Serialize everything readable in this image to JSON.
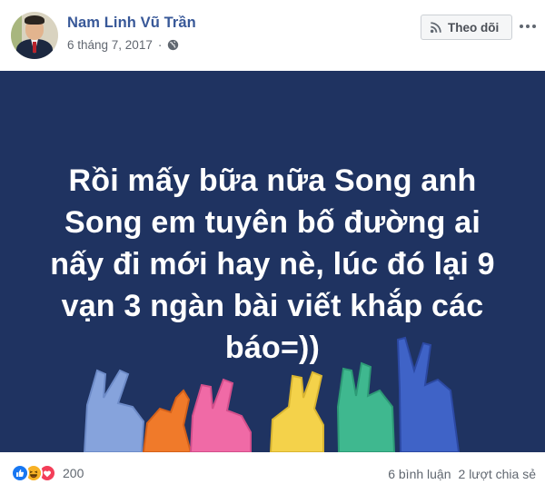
{
  "post": {
    "author": "Nam Linh Vũ Trần",
    "date": "6 tháng 7, 2017",
    "separator": "·",
    "privacy_icon": "globe-icon",
    "follow_icon": "rss-icon",
    "follow_label": "Theo dõi",
    "more_icon": "ellipsis-icon",
    "image_text": "Rồi mấy bữa nữa Song anh Song em tuyên bố đường ai nấy đi mới hay nè, lúc đó lại 9 vạn 3 ngàn bài viết khắp các báo=))",
    "image_background": "#1f3361"
  },
  "footer": {
    "reactions": [
      "like-icon",
      "haha-icon",
      "love-icon"
    ],
    "reaction_count": "200",
    "comments": "6 bình luận",
    "shares": "2 lượt chia sẻ"
  },
  "colors": {
    "name_link": "#385898",
    "meta_text": "#616770",
    "like": "#1877f2",
    "haha": "#f7b125",
    "love": "#f33e58"
  }
}
